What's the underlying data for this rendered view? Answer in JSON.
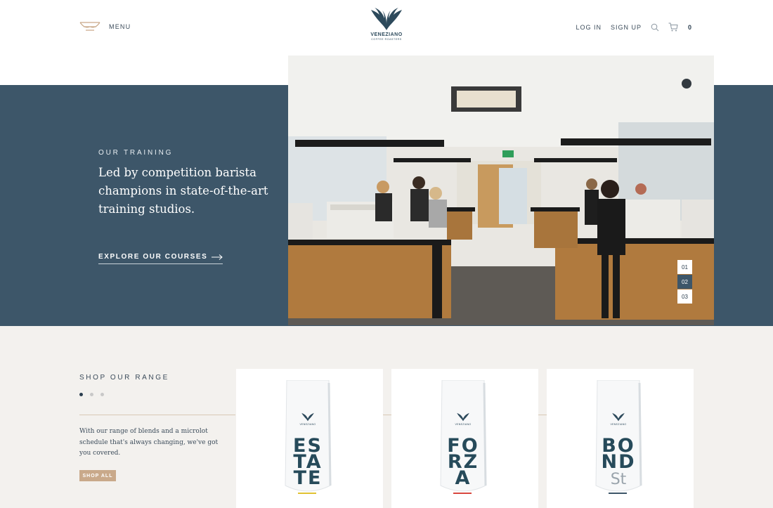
{
  "header": {
    "menu_label": "MENU",
    "logo_name": "VENEZIANO",
    "logo_sub": "COFFEE ROASTERS",
    "login_label": "LOG IN",
    "signup_label": "SIGN UP",
    "cart_count": "0"
  },
  "training": {
    "eyebrow": "OUR TRAINING",
    "headline": "Led by competition barista champions in state-of-the-art training studios.",
    "cta_label": "EXPLORE OUR COURSES",
    "slides": [
      {
        "label": "01",
        "active": false
      },
      {
        "label": "02",
        "active": true
      },
      {
        "label": "03",
        "active": false
      }
    ]
  },
  "shop": {
    "heading": "SHOP OUR RANGE",
    "copy": "With our range of blends and a microlot schedule that's always changing, we've got you covered.",
    "button_label": "SHOP ALL",
    "products": [
      {
        "lines": [
          "ES",
          "TA",
          "TE"
        ],
        "stripe": "#e0c232"
      },
      {
        "lines": [
          "FO",
          "RZ",
          "A"
        ],
        "stripe": "#d8473f"
      },
      {
        "lines": [
          "BO",
          "ND",
          "St"
        ],
        "stripe": "#3d5669"
      }
    ]
  },
  "colors": {
    "brand_navy": "#3d5669",
    "accent_tan": "#c9a98a",
    "shop_background": "#f3f1ee"
  }
}
